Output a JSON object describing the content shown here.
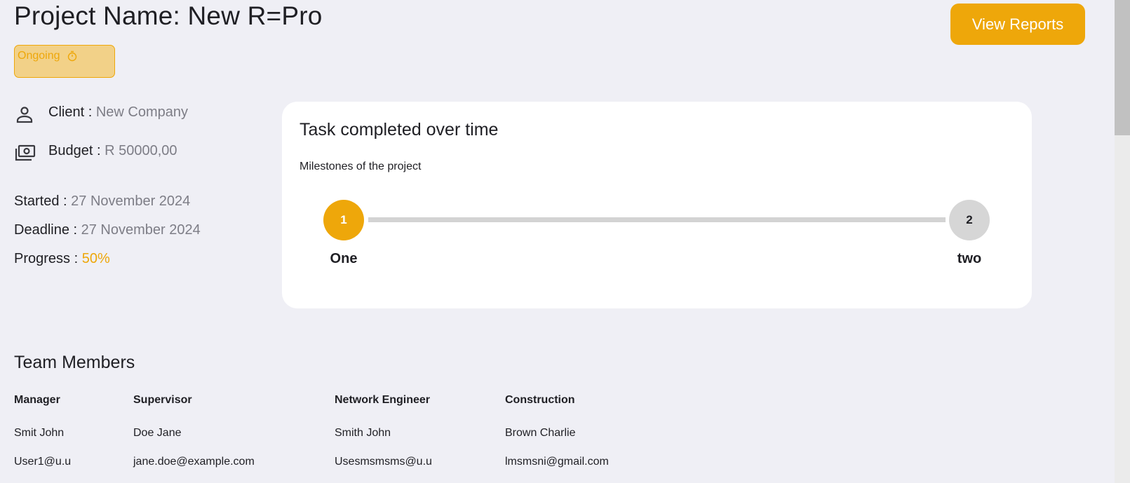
{
  "header": {
    "project_title": "Project Name: New R=Pro",
    "view_reports_label": "View Reports",
    "status_label": "Ongoing",
    "status_icon": "timer-icon"
  },
  "details": {
    "client_label": "Client :",
    "client_value": "New Company",
    "budget_label": "Budget :",
    "budget_value": "R 50000,00",
    "started_label": "Started :",
    "started_value": "27 November 2024",
    "deadline_label": "Deadline :",
    "deadline_value": "27 November 2024",
    "progress_label": "Progress :",
    "progress_value": "50%"
  },
  "milestones": {
    "title": "Task completed over time",
    "subtitle": "Milestones of the project",
    "items": [
      {
        "number": "1",
        "label": "One",
        "done": true
      },
      {
        "number": "2",
        "label": "two",
        "done": false
      }
    ]
  },
  "team": {
    "title": "Team Members",
    "columns": [
      {
        "role": "Manager",
        "name": "Smit John",
        "email": "User1@u.u"
      },
      {
        "role": "Supervisor",
        "name": "Doe Jane",
        "email": "jane.doe@example.com"
      },
      {
        "role": "Network Engineer",
        "name": "Smith John",
        "email": "Usesmsmsms@u.u"
      },
      {
        "role": "Construction",
        "name": "Brown Charlie",
        "email": "lmsmsni@gmail.com"
      }
    ]
  },
  "colors": {
    "accent": "#eea70a",
    "background": "#efeff5",
    "muted": "#7d7d86"
  }
}
